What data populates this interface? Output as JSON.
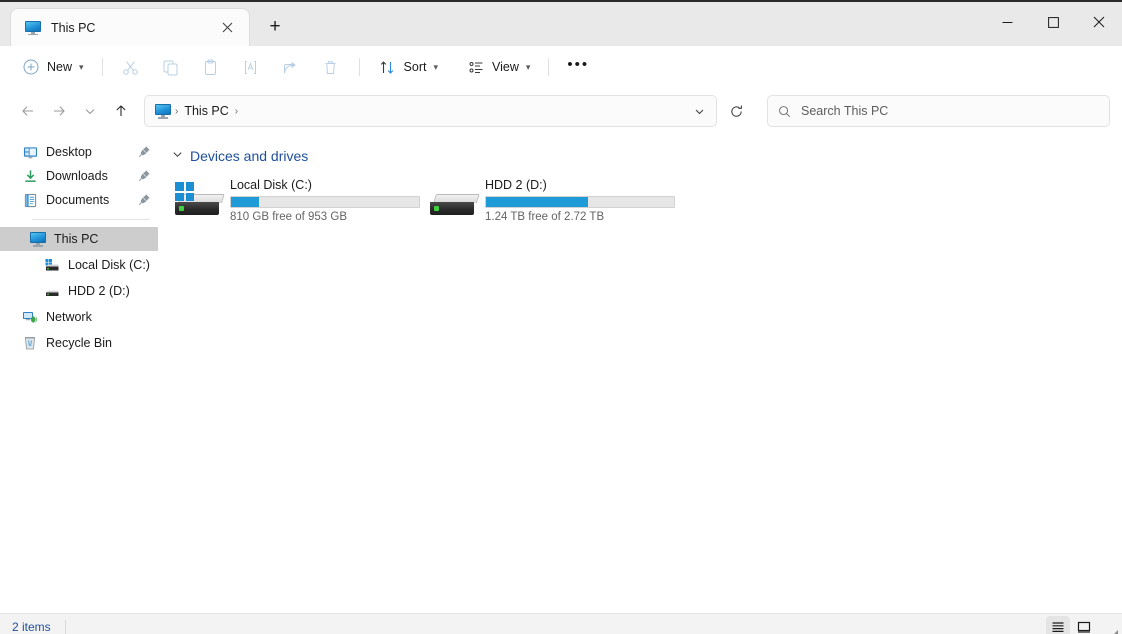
{
  "window": {
    "tab": {
      "title": "This PC",
      "icon": "monitor-icon",
      "close": "✕"
    },
    "new_tab": "+",
    "controls": {
      "minimize": "minimize-icon",
      "maximize": "maximize-icon",
      "close": "close-icon"
    }
  },
  "toolbar": {
    "new_label": "New",
    "chevron": "⌄",
    "items": [
      {
        "name": "cut",
        "label": "Cut",
        "icon": "scissors-icon",
        "enabled": false
      },
      {
        "name": "copy",
        "label": "Copy",
        "icon": "copy-icon",
        "enabled": false
      },
      {
        "name": "paste",
        "label": "Paste",
        "icon": "clipboard-icon",
        "enabled": false
      },
      {
        "name": "rename",
        "label": "Rename",
        "icon": "rename-icon",
        "enabled": false
      },
      {
        "name": "share",
        "label": "Share",
        "icon": "share-icon",
        "enabled": false
      },
      {
        "name": "delete",
        "label": "Delete",
        "icon": "trash-icon",
        "enabled": false
      }
    ],
    "sort_label": "Sort",
    "view_label": "View",
    "overflow_label": "•••"
  },
  "address": {
    "crumbs": [
      "This PC"
    ],
    "separator": "›",
    "icon": "monitor-icon",
    "dropdown": "chevron-down-icon",
    "refresh": "refresh-icon"
  },
  "search": {
    "placeholder": "Search This PC",
    "icon": "search-icon"
  },
  "navigation": {
    "back": "back-arrow-icon",
    "forward": "forward-arrow-icon",
    "recent": "chevron-down-icon",
    "up": "up-arrow-icon"
  },
  "sidebar": {
    "quick_items": [
      {
        "label": "Desktop",
        "icon": "desktop-icon",
        "pinned": true
      },
      {
        "label": "Downloads",
        "icon": "downloads-icon",
        "pinned": true
      },
      {
        "label": "Documents",
        "icon": "documents-icon",
        "pinned": true
      }
    ],
    "tree_items": [
      {
        "label": "This PC",
        "icon": "monitor-icon",
        "selected": true,
        "indent": 0
      },
      {
        "label": "Local Disk (C:)",
        "icon": "drive-windows-icon",
        "selected": false,
        "indent": 1
      },
      {
        "label": "HDD 2 (D:)",
        "icon": "drive-icon",
        "selected": false,
        "indent": 1
      },
      {
        "label": "Network",
        "icon": "network-icon",
        "selected": false,
        "indent": 0
      },
      {
        "label": "Recycle Bin",
        "icon": "recycle-bin-icon",
        "selected": false,
        "indent": 0
      }
    ]
  },
  "content": {
    "group_title": "Devices and drives",
    "group_chevron": "⌄",
    "drives": [
      {
        "name": "Local Disk (C:)",
        "capacity_text": "810 GB free of 953 GB",
        "free": "810 GB",
        "total": "953 GB",
        "used_percent": 15,
        "icon": "drive-windows-icon"
      },
      {
        "name": "HDD 2 (D:)",
        "capacity_text": "1.24 TB free of 2.72 TB",
        "free": "1.24 TB",
        "total": "2.72 TB",
        "used_percent": 54,
        "icon": "drive-icon"
      }
    ]
  },
  "status": {
    "item_count": "2 items",
    "details_view": "details-view-icon",
    "icons_view": "large-icons-icon"
  },
  "colors": {
    "accent": "#1f9cd8",
    "link": "#1f4f9c",
    "selection": "#cdcdcd",
    "titlebar": "#e9e9e9"
  }
}
